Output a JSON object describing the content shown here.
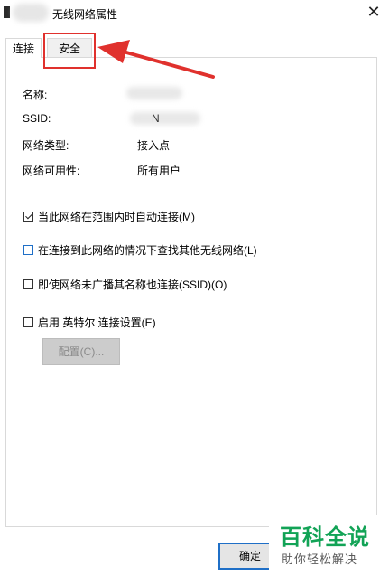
{
  "window": {
    "title": "无线网络属性",
    "close_glyph": "✕"
  },
  "tabs": [
    {
      "label": "连接",
      "active": true
    },
    {
      "label": "安全",
      "active": false
    }
  ],
  "properties": [
    {
      "label": "名称:",
      "value": ""
    },
    {
      "label": "SSID:",
      "value": "N"
    },
    {
      "label": "网络类型:",
      "value": "接入点"
    },
    {
      "label": "网络可用性:",
      "value": "所有用户"
    }
  ],
  "options": [
    {
      "label": "当此网络在范围内时自动连接(M)",
      "checked": true
    },
    {
      "label": "在连接到此网络的情况下查找其他无线网络(L)",
      "checked": false
    },
    {
      "label": "即使网络未广播其名称也连接(SSID)(O)",
      "checked": false
    },
    {
      "label": "启用 英特尔 连接设置(E)",
      "checked": false
    }
  ],
  "buttons": {
    "configure": "配置(C)...",
    "ok": "确定"
  },
  "watermark": {
    "title": "百科全说",
    "subtitle": "助你轻松解决"
  },
  "colors": {
    "highlight": "#e0312d",
    "accent": "#1f6fc7",
    "watermark": "#12a356"
  }
}
